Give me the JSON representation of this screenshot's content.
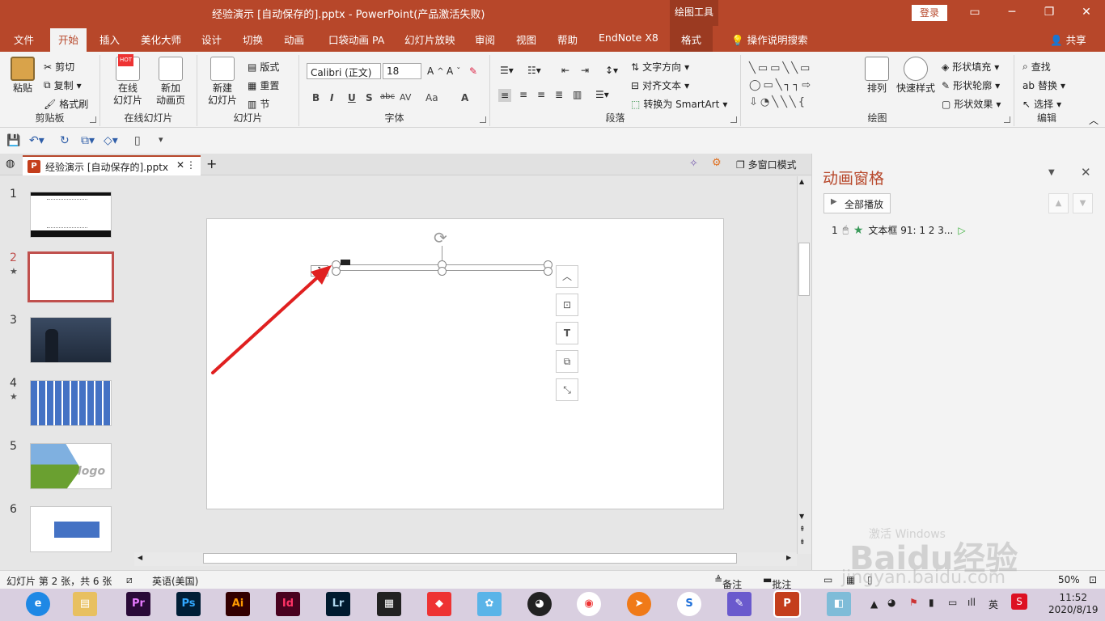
{
  "titlebar": {
    "title": "经验演示 [自动保存的].pptx  -  PowerPoint(产品激活失败)",
    "context_tab": "绘图工具",
    "login": "登录"
  },
  "tabs": [
    "文件",
    "开始",
    "插入",
    "美化大师",
    "设计",
    "切换",
    "动画",
    "口袋动画 PA",
    "幻灯片放映",
    "审阅",
    "视图",
    "帮助",
    "EndNote X8",
    "格式"
  ],
  "tell_me": "操作说明搜索",
  "share": "共享",
  "ribbon": {
    "clipboard": {
      "paste": "粘贴",
      "cut": "剪切",
      "copy": "复制",
      "format_painter": "格式刷",
      "label": "剪贴板"
    },
    "online": {
      "online_slides_line1": "在线",
      "online_slides_line2": "幻灯片",
      "new_anim_line1": "新加",
      "new_anim_line2": "动画页",
      "label": "在线幻灯片",
      "hot": "HOT"
    },
    "slides": {
      "new_line1": "新建",
      "new_line2": "幻灯片",
      "layout": "版式",
      "reset": "重置",
      "section": "节",
      "label": "幻灯片"
    },
    "font": {
      "name": "Calibri (正文)",
      "size": "18",
      "label": "字体",
      "bold": "B",
      "italic": "I",
      "underline": "U",
      "shadow": "S",
      "strike": "abc",
      "spacing": "AV",
      "case": "Aa",
      "color": "A"
    },
    "paragraph": {
      "text_direction": "文字方向",
      "align_text": "对齐文本",
      "smartart": "转换为 SmartArt",
      "label": "段落"
    },
    "drawing": {
      "arrange": "排列",
      "quick_styles": "快速样式",
      "fill": "形状填充",
      "outline": "形状轮廓",
      "effects": "形状效果",
      "label": "绘图"
    },
    "editing": {
      "find": "查找",
      "replace": "替换",
      "select": "选择",
      "label": "编辑"
    }
  },
  "doc_tab": {
    "name": "经验演示 [自动保存的].pptx",
    "multi_window": "多窗口模式"
  },
  "thumbnails": [
    {
      "num": "1",
      "star": ""
    },
    {
      "num": "2",
      "star": "★"
    },
    {
      "num": "3",
      "star": ""
    },
    {
      "num": "4",
      "star": "★"
    },
    {
      "num": "5",
      "star": "",
      "logo": "logo"
    },
    {
      "num": "6",
      "star": ""
    }
  ],
  "slide": {
    "anim_tag": "1"
  },
  "animation_pane": {
    "title": "动画窗格",
    "play_all": "全部播放",
    "item_index": "1",
    "item_label": "文本框 91: 1 2 3..."
  },
  "status": {
    "slide_info": "幻灯片 第 2 张，共 6 张",
    "language": "英语(美国)",
    "notes": "备注",
    "comments": "批注",
    "zoom": "50%"
  },
  "taskbar": {
    "apps": [
      "Pr",
      "Ps",
      "Ai",
      "Id",
      "Lr"
    ],
    "ime": "英",
    "time": "11:52",
    "date": "2020/8/19"
  },
  "watermark": {
    "text": "Baidu经验",
    "url": "jingyan.baidu.com",
    "activate": "激活 Windows"
  },
  "colors": {
    "accent": "#b7472a",
    "ribbon": "#f3f3f3",
    "selection": "#c0504d",
    "arrow": "#e02020"
  }
}
